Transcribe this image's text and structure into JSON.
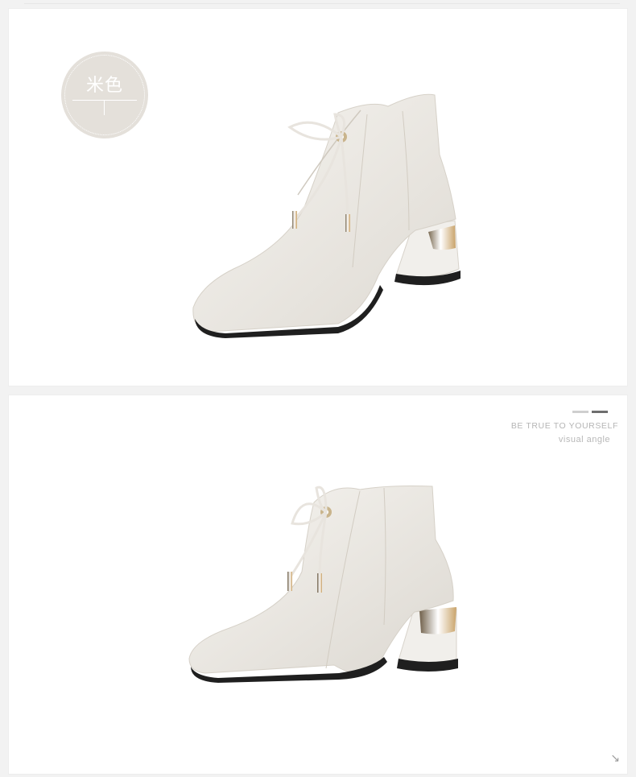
{
  "color_badge": {
    "label": "米色"
  },
  "caption": {
    "tagline": "BE TRUE TO YOURSELF",
    "subline": "visual angle"
  },
  "icons": {
    "arrow": "arrow-down-right-icon"
  },
  "colors": {
    "boot_leather": "#efece6",
    "heel_metal": "#c9a36a",
    "sole": "#222222",
    "badge": "#e4e0da"
  }
}
